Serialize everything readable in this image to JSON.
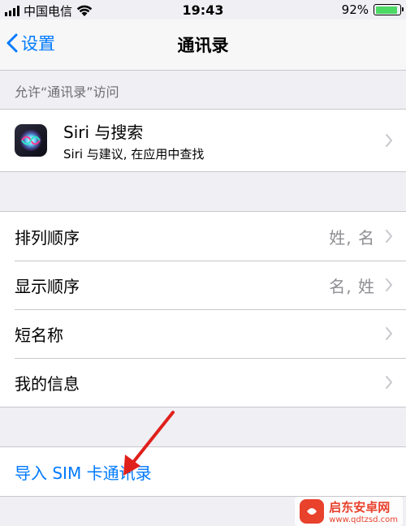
{
  "status_bar": {
    "carrier": "中国电信",
    "time": "19:43",
    "battery_percent": "92%",
    "battery_level": 0.92,
    "battery_color": "#4cd964"
  },
  "nav": {
    "back_label": "设置",
    "title": "通讯录"
  },
  "section": {
    "header": "允许“通讯录”访问"
  },
  "siri": {
    "title": "Siri 与搜索",
    "subtitle": "Siri 与建议, 在应用中查找",
    "icon": "siri-icon"
  },
  "settings": {
    "sort_order_label": "排列顺序",
    "sort_order_value": "姓, 名",
    "display_order_label": "显示顺序",
    "display_order_value": "名, 姓",
    "short_name_label": "短名称",
    "my_info_label": "我的信息"
  },
  "import": {
    "label": "导入 SIM 卡通讯录"
  },
  "accent_color": "#007aff",
  "watermark": {
    "brand": "启东安卓网",
    "url": "www.qdtzsd.com"
  }
}
